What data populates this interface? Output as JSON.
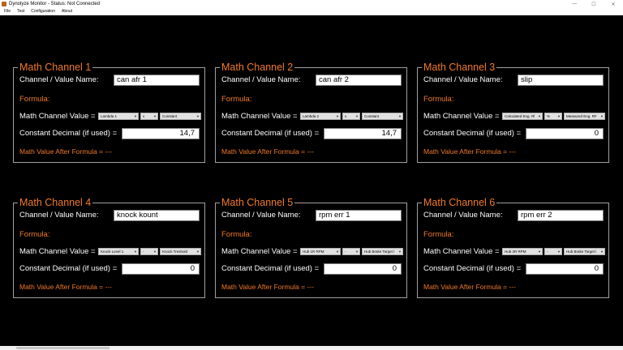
{
  "window": {
    "title": "Dynolyze Monitor - Status: Not Connected",
    "minimize": "—",
    "maximize": "☐",
    "close": "✕"
  },
  "menu": [
    "File",
    "Test",
    "Configuration",
    "About"
  ],
  "labels": {
    "channel_name": "Channel / Value Name:",
    "formula": "Formula:",
    "value": "Math Channel Value =",
    "constant": "Constant Decimal (if used) =",
    "after": "Math Value After Formula = ---"
  },
  "channels": [
    {
      "title": "Math Channel 1",
      "name": "can afr 1",
      "combo1": "Lambda 1",
      "op": "x",
      "combo2": "Constant",
      "constant": "14,7"
    },
    {
      "title": "Math Channel 2",
      "name": "can afr 2",
      "combo1": "Lambda 2",
      "op": "x",
      "combo2": "Constant",
      "constant": "14,7"
    },
    {
      "title": "Math Channel 3",
      "name": "slip",
      "combo1": "Calculated Eng. Rl",
      "op": "%",
      "combo2": "Measured Eng. RF",
      "constant": "0"
    },
    {
      "title": "Math Channel 4",
      "name": "knock kount",
      "combo1": "Knock Level 1",
      "op": "-",
      "combo2": "Knock Treshold",
      "constant": "0"
    },
    {
      "title": "Math Channel 5",
      "name": "rpm err 1",
      "combo1": "Hub 1R RPM",
      "op": "-",
      "combo2": "Hub Brake Target l",
      "constant": "0"
    },
    {
      "title": "Math Channel 6",
      "name": "rpm err 2",
      "combo1": "Hub 2R RPM",
      "op": "-",
      "combo2": "Hub Brake Target l",
      "constant": "0"
    }
  ]
}
